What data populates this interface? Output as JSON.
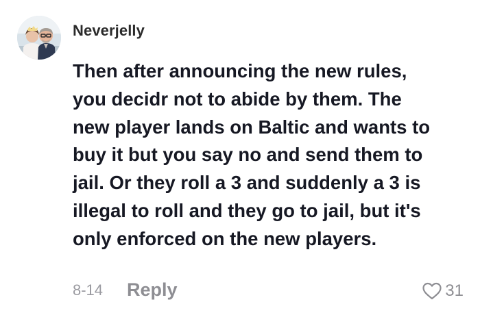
{
  "comment": {
    "username": "Neverjelly",
    "avatar_icon": "profile-photo",
    "text_lines": [
      "Then after announcing the new rules,",
      "you decidr not to abide by them. The",
      "new player lands on Baltic and wants to",
      "buy it but you say no and send them to",
      "jail. Or they roll a 3 and suddenly a 3 is",
      "illegal to roll and they go to jail, but it's",
      "only enforced on the new players."
    ],
    "date": "8-14",
    "reply_label": "Reply",
    "like_icon": "heart-outline-icon",
    "like_count": "31"
  },
  "colors": {
    "text": "#161823",
    "muted": "#8e8e93",
    "background": "#ffffff"
  }
}
